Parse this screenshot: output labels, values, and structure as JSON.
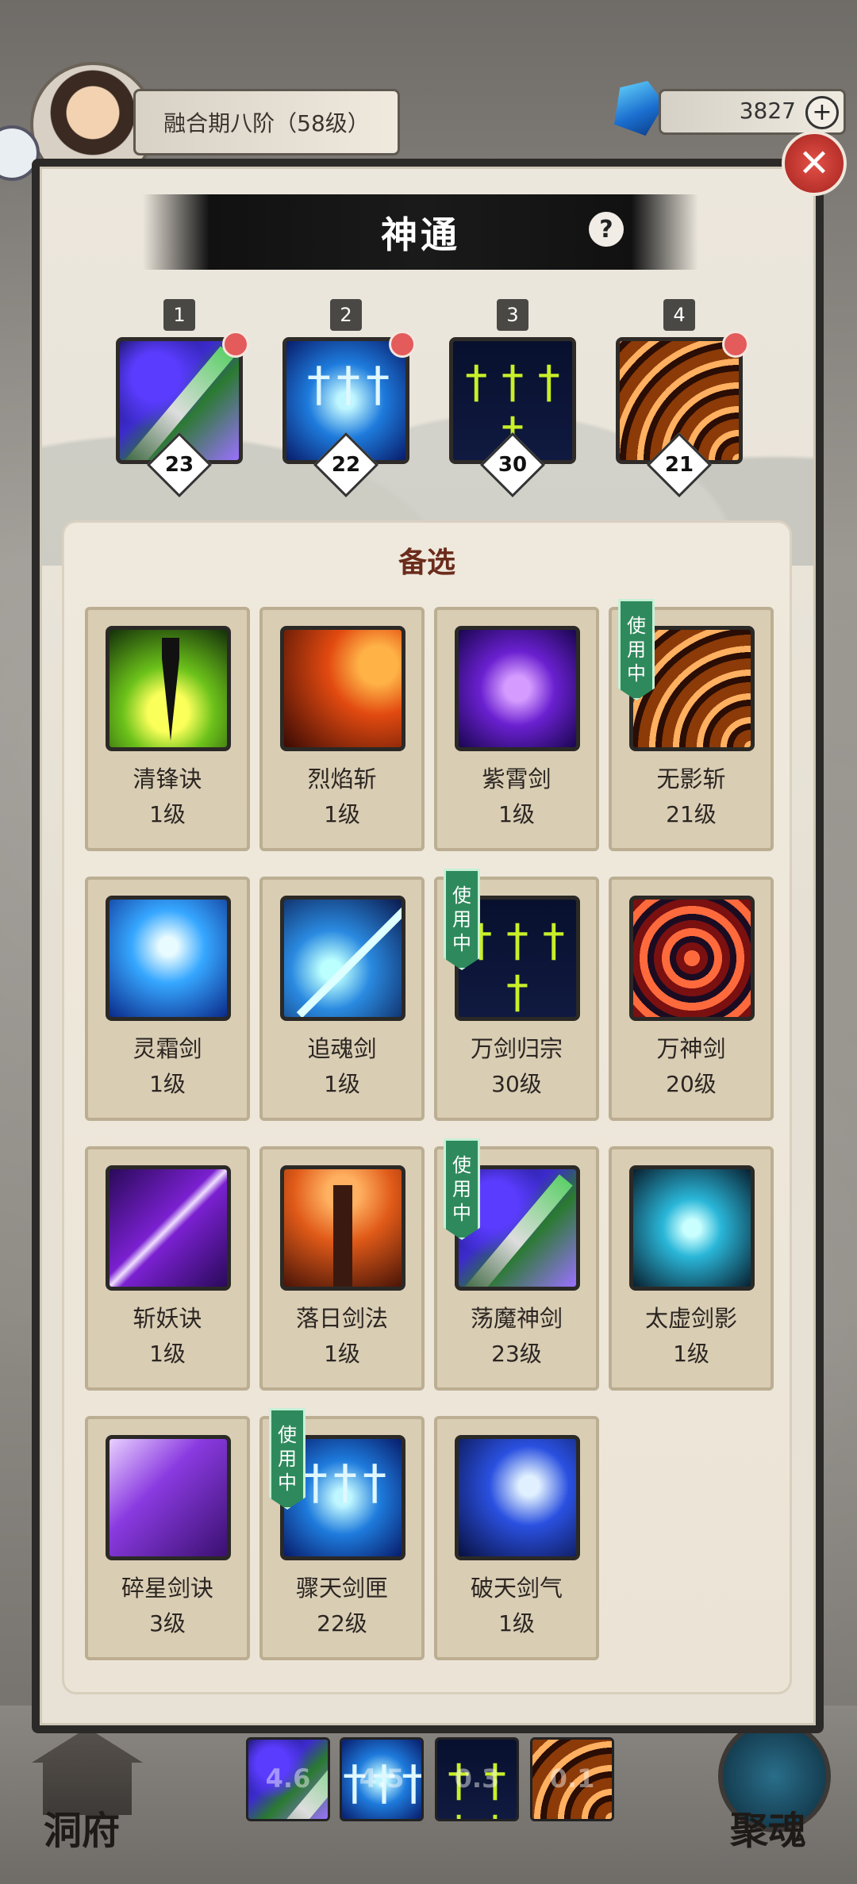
{
  "header": {
    "realm_label": "融合期八阶（58级）",
    "currency_value": "3827",
    "currency_plus": "+"
  },
  "modal": {
    "title": "神通",
    "help": "?",
    "close": "✕"
  },
  "equipped": [
    {
      "slot": "1",
      "level": "23",
      "icon": "dangmo-sword-icon",
      "has_dot": true
    },
    {
      "slot": "2",
      "level": "22",
      "icon": "zhoutian-sword-icon",
      "has_dot": true
    },
    {
      "slot": "3",
      "level": "30",
      "icon": "wanjian-sword-icon",
      "has_dot": false
    },
    {
      "slot": "4",
      "level": "21",
      "icon": "wuying-slash-icon",
      "has_dot": true
    }
  ],
  "candidates": {
    "title": "备选",
    "in_use_label": [
      "使",
      "用",
      "中"
    ],
    "items": [
      {
        "name": "清锋诀",
        "level": "1级",
        "icon": "qingfeng-icon",
        "in_use": false
      },
      {
        "name": "烈焰斩",
        "level": "1级",
        "icon": "lieyan-icon",
        "in_use": false
      },
      {
        "name": "紫霄剑",
        "level": "1级",
        "icon": "zixiao-icon",
        "in_use": false
      },
      {
        "name": "无影斩",
        "level": "21级",
        "icon": "wuying-icon",
        "in_use": true
      },
      {
        "name": "灵霜剑",
        "level": "1级",
        "icon": "linshuang-icon",
        "in_use": false
      },
      {
        "name": "追魂剑",
        "level": "1级",
        "icon": "zhuihun-icon",
        "in_use": false
      },
      {
        "name": "万剑归宗",
        "level": "30级",
        "icon": "wanjian-icon",
        "in_use": true
      },
      {
        "name": "万神剑",
        "level": "20级",
        "icon": "wanshen-icon",
        "in_use": false
      },
      {
        "name": "斩妖诀",
        "level": "1级",
        "icon": "zhanyao-icon",
        "in_use": false
      },
      {
        "name": "落日剑法",
        "level": "1级",
        "icon": "luori-icon",
        "in_use": false
      },
      {
        "name": "荡魔神剑",
        "level": "23级",
        "icon": "dangmo-icon",
        "in_use": true
      },
      {
        "name": "太虚剑影",
        "level": "1级",
        "icon": "taixu-icon",
        "in_use": false
      },
      {
        "name": "碎星剑诀",
        "level": "3级",
        "icon": "suixing-icon",
        "in_use": false
      },
      {
        "name": "骤天剑匣",
        "level": "22级",
        "icon": "zhoutian-icon",
        "in_use": true
      },
      {
        "name": "破天剑气",
        "level": "1级",
        "icon": "potian-icon",
        "in_use": false
      }
    ]
  },
  "bottom": {
    "left_label": "洞府",
    "right_label": "聚魂",
    "quick_slots": [
      "4.6",
      "4.5",
      "0.3",
      "0.1"
    ]
  }
}
